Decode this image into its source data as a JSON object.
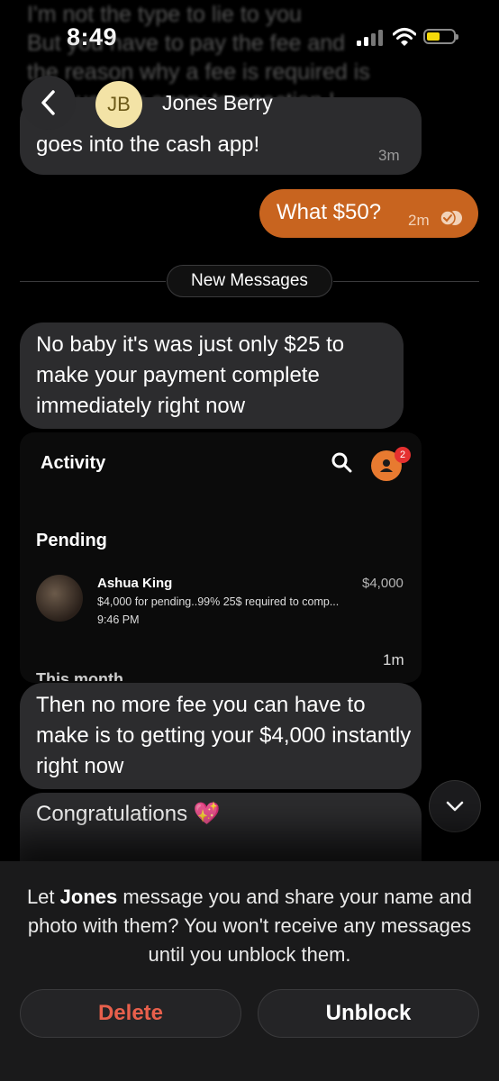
{
  "status_bar": {
    "time": "8:49"
  },
  "background_text": {
    "lines": [
      "I'm not the type to lie to you",
      "But you have to pay the fee and",
      "the reason why a fee is required is",
      "because for every transaction I"
    ]
  },
  "header": {
    "avatar_initials": "JB",
    "contact_name": "Jones Berry"
  },
  "messages": {
    "m1": {
      "text": "goes into the cash app!",
      "time": "3m"
    },
    "m2": {
      "text": "What $50?",
      "time": "2m"
    },
    "new_messages_label": "New Messages",
    "m3": {
      "text": "No baby it's was just only $25 to make your payment complete immediately right now"
    },
    "attachment": {
      "title": "Activity",
      "badge_count": "2",
      "section": "Pending",
      "payer_name": "Ashua King",
      "amount": "$4,000",
      "note": "$4,000 for pending..99% 25$ required to comp...",
      "payment_time": "9:46 PM",
      "cut_text": "This month",
      "time": "1m"
    },
    "m4": {
      "text": "Then no more fee you can have to make is to getting your $4,000 instantly right now"
    },
    "m5": {
      "text": "Congratulations 💖"
    }
  },
  "block_panel": {
    "prefix": "Let ",
    "name": "Jones",
    "suffix": " message you and share your name and photo with them? You won't receive any messages until you unblock them.",
    "delete_label": "Delete",
    "unblock_label": "Unblock"
  },
  "colors": {
    "outgoing_bubble": "#c8641f",
    "incoming_bubble": "#2c2c2e",
    "delete_text": "#e8604c",
    "avatar_bg": "#f3e3a6"
  }
}
